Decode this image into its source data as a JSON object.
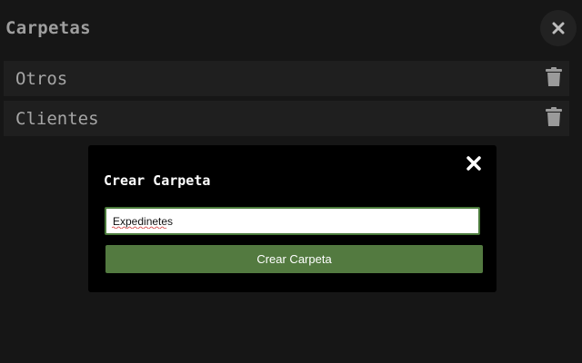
{
  "panel": {
    "title": "Carpetas",
    "close_icon": "close-icon"
  },
  "folders": [
    {
      "label": "Otros",
      "icon": "trash-icon"
    },
    {
      "label": "Clientes",
      "icon": "trash-icon"
    }
  ],
  "modal": {
    "title": "Crear Carpeta",
    "close_icon": "close-icon",
    "input_value": "Expedinetes",
    "button_label": "Crear Carpeta"
  },
  "colors": {
    "background": "#161616",
    "row": "#1f1f1f",
    "modal": "#000000",
    "accent": "#537a40",
    "input_border": "#4a7a3b"
  }
}
